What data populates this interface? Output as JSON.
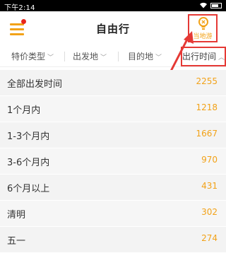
{
  "status_bar": {
    "time": "下午2:14"
  },
  "header": {
    "title": "自由行",
    "local_tour_label": "当地游"
  },
  "filters": [
    {
      "label": "特价类型",
      "icon": "chevron-down-icon"
    },
    {
      "label": "出发地",
      "icon": "chevron-down-icon"
    },
    {
      "label": "目的地",
      "icon": "chevron-down-icon"
    },
    {
      "label": "出行时间",
      "icon": "chevron-up-icon"
    }
  ],
  "list": {
    "items": [
      {
        "label": "全部出发时间",
        "count": "2255"
      },
      {
        "label": "1个月内",
        "count": "1218"
      },
      {
        "label": "1-3个月内",
        "count": "1667"
      },
      {
        "label": "3-6个月内",
        "count": "970"
      },
      {
        "label": "6个月以上",
        "count": "431"
      },
      {
        "label": "清明",
        "count": "302"
      },
      {
        "label": "五一",
        "count": "274"
      }
    ]
  },
  "colors": {
    "accent": "#f2a218",
    "annotation_red": "#e53935",
    "notification_dot": "#e8251b"
  }
}
